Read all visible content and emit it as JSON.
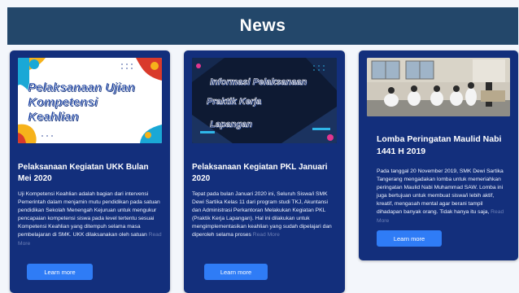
{
  "header": {
    "title": "News"
  },
  "cards": [
    {
      "thumb_text": [
        "Pelaksanaan Ujian",
        "Kompetensi",
        "Keahlian"
      ],
      "title": "Pelaksanaan Kegiatan UKK Bulan Mei 2020",
      "desc": "Uji Kompetensi Keahlian adalah bagian dari intervensi Pemerintah dalam menjamin mutu pendidikan pada satuan pendidikan Sekolah Menengah Kejuruan untuk mengukur pencapaian kompetensi siswa pada level tertentu sesuai Kompetensi Keahlian yang ditempuh selama masa pembelajaran di SMK. UKK dilaksanakan oleh satuan",
      "read_more": "Read More",
      "button": "Learn more"
    },
    {
      "thumb_text": [
        "Informasi Pelaksanaan",
        "Praktik Kerja",
        "Lapangan"
      ],
      "title": "Pelaksanaan Kegiatan PKL Januari 2020",
      "desc": "Tepat pada bulan Januari 2020 ini, Seluruh Siswa/i SMK Dewi Sartika Kelas 11 dari program studi TKJ, Akuntansi dan Administrasi Perkantoran Melakukan Kegiatan PKL (Praktik Kerja Lapangan). Hal ini dilakukan untuk mengimplementasikan keahlian yang sudah dipelajari dan diperoleh selama proses",
      "read_more": "Read More",
      "button": "Learn more"
    },
    {
      "title": "Lomba Peringatan Maulid Nabi 1441 H 2019",
      "desc": "Pada tanggal 20 November 2019, SMK Dewi Sartika Tangerang mengadakan lomba untuk memeriahkan peringatan Maulid Nabi Muhammad SAW. Lomba ini juga bertujuan untuk membuat siswa/i lebih aktif, kreatif, mengasah mental agar berani tampil dihadapan banyak orang. Tidak hanya itu saja,",
      "read_more": "Read More",
      "button": "Learn more"
    }
  ],
  "colors": {
    "header_bg": "#23476a",
    "card_bg": "#132f7c",
    "button_bg": "#2f7cf6",
    "page_bg": "#f3f6fb"
  }
}
